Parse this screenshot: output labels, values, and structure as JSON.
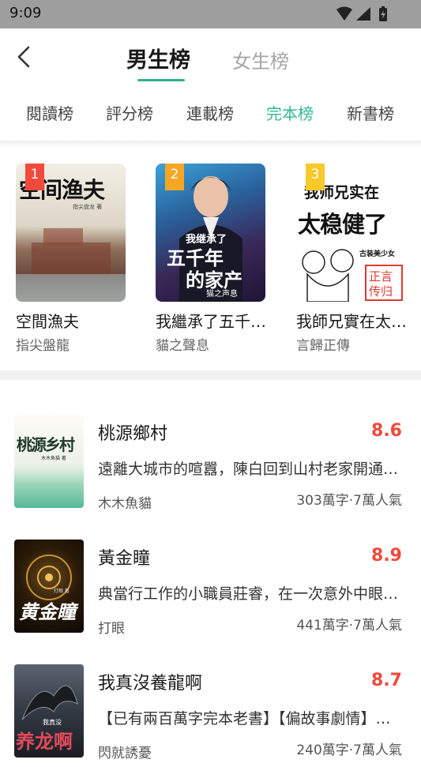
{
  "status": {
    "time": "9:09"
  },
  "nav": {
    "back_icon": "chevron-left-icon",
    "gender_tabs": [
      "男生榜",
      "女生榜"
    ],
    "active_gender": 0
  },
  "subtabs": [
    "閱讀榜",
    "評分榜",
    "連載榜",
    "完本榜",
    "新書榜"
  ],
  "active_subtab": 3,
  "podium": [
    {
      "rank": "1",
      "title": "空間漁夫",
      "author": "指尖盤龍",
      "cover_text": "空间渔夫",
      "cover_sub": "指尖盘龙 著"
    },
    {
      "rank": "2",
      "title": "我繼承了五千…",
      "author": "貓之聲息",
      "cover_text_top": "我继承了",
      "cover_text_mid": "五千年",
      "cover_text_bot": "的家产",
      "cover_author": "猫之声息"
    },
    {
      "rank": "3",
      "title": "我師兄實在太…",
      "author": "言歸正傳",
      "cover_text_top": "我师兄实在",
      "cover_text_big": "太稳健了",
      "cover_tag": "古装美少女",
      "cover_seal": "正言传归"
    }
  ],
  "list": [
    {
      "title": "桃源鄉村",
      "score": "8.6",
      "desc": "遠離大城市的喧囂，陳白回到山村老家開通…",
      "author": "木木魚貓",
      "meta": "303萬字·7萬人氣",
      "cover_text": "桃源乡村",
      "cover_sub": "木木鱼猫 著"
    },
    {
      "title": "黃金瞳",
      "score": "8.9",
      "desc": "典當行工作的小職員莊睿，在一次意外中眼…",
      "author": "打眼",
      "meta": "441萬字·7萬人氣",
      "cover_text": "黄金瞳",
      "cover_sub": "打眼 著"
    },
    {
      "title": "我真沒養龍啊",
      "score": "8.7",
      "desc": "【已有兩百萬字完本老書】【偏故事劇情】…",
      "author": "閃就誘憂",
      "meta": "240萬字·7萬人氣",
      "cover_text": "养龙啊",
      "cover_sub": "我真没"
    }
  ]
}
